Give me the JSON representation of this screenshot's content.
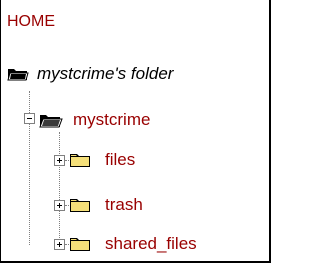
{
  "tree": {
    "home_label": "HOME",
    "root_folder_label": "mystcrime's folder",
    "user_folder_label": "mystcrime",
    "children": [
      {
        "label": "files"
      },
      {
        "label": "trash"
      },
      {
        "label": "shared_files"
      }
    ]
  },
  "colors": {
    "link_red": "#990000",
    "folder_yellow": "#f5e07a",
    "folder_dark": "#000000"
  },
  "icons": {
    "root": "open-folder-dark-icon",
    "user": "open-folder-icon",
    "child": "folder-icon"
  }
}
